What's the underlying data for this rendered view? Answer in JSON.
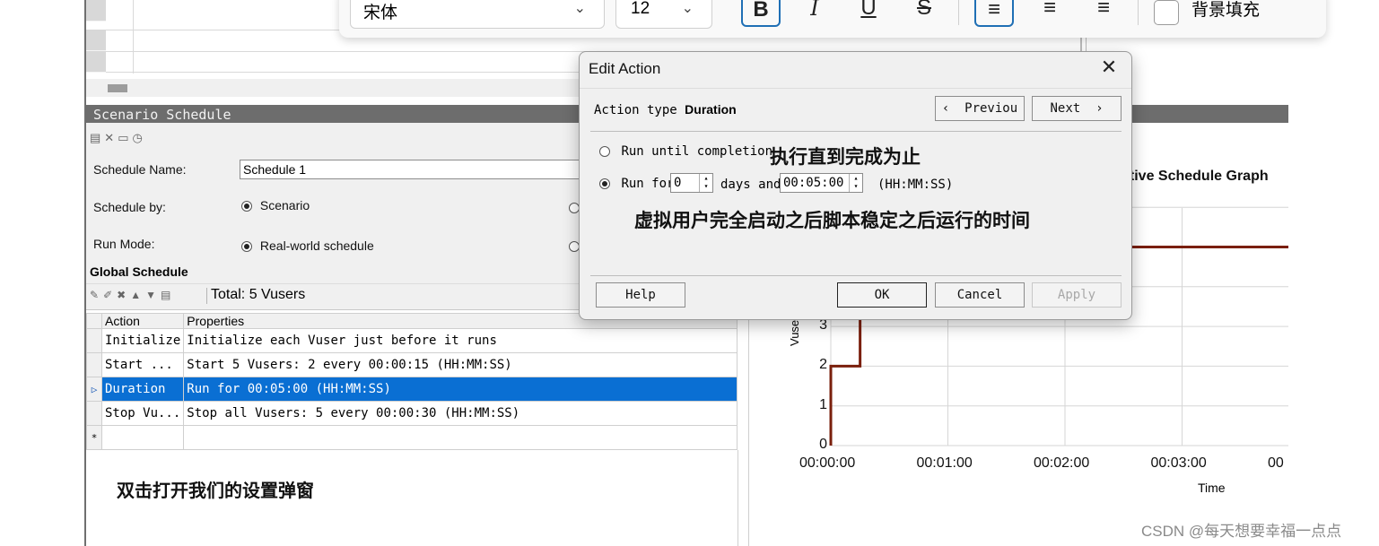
{
  "format_toolbar": {
    "font_name": "宋体",
    "font_size": "12",
    "bold": "B",
    "italic": "I",
    "underline": "U",
    "strikethrough": "S",
    "fill_label": "背景填充"
  },
  "scenario": {
    "title": "Scenario Schedule",
    "schedule_name_label": "Schedule Name:",
    "schedule_name_value": "Schedule 1",
    "schedule_by_label": "Schedule by:",
    "schedule_by_value": "Scenario",
    "run_mode_label": "Run Mode:",
    "run_mode_value": "Real-world schedule"
  },
  "global": {
    "title": "Global Schedule",
    "total": "Total: 5 Vusers",
    "columns": [
      "Action",
      "Properties"
    ],
    "rows": [
      {
        "action": "Initialize",
        "properties": "Initialize each Vuser just before it runs"
      },
      {
        "action": "Start  ...",
        "properties": "Start 5 Vusers: 2 every 00:00:15 (HH:MM:SS)"
      },
      {
        "action": "Duration",
        "properties": "Run for 00:05:00 (HH:MM:SS)"
      },
      {
        "action": "Stop Vu...",
        "properties": "Stop all Vusers: 5 every 00:00:30 (HH:MM:SS)"
      }
    ],
    "new_row_marker": "*",
    "selected_marker": "▷"
  },
  "annotation_bottom": "双击打开我们的设置弹窗",
  "graph": {
    "title": "ctive Schedule Graph",
    "x_ticks": [
      "00:00:00",
      "00:01:00",
      "00:02:00",
      "00:03:00",
      "00"
    ],
    "y_ticks": [
      "0",
      "1",
      "2",
      "3"
    ],
    "xlabel": "Time",
    "ylabel": "Vuse"
  },
  "chart_data": {
    "type": "line",
    "title": "ctive Schedule Graph",
    "xlabel": "Time",
    "ylabel": "Vuse",
    "series": [
      {
        "x_minutes": [
          0,
          0,
          0.25,
          0.25,
          0.5,
          5.0
        ],
        "y": [
          0,
          2,
          2,
          4,
          5,
          5
        ]
      }
    ],
    "x_ticks": [
      "00:00:00",
      "00:01:00",
      "00:02:00",
      "00:03:00",
      "00"
    ],
    "y_ticks": [
      0,
      1,
      2,
      3
    ],
    "grid": true,
    "line_color": "#7a1f0c"
  },
  "dialog": {
    "title": "Edit Action",
    "close": "✕",
    "action_type_label": "Action type",
    "action_type_value": "Duration",
    "prev_label": "Previou",
    "next_label": "Next",
    "option_completion": "Run until completion",
    "option_run_for": "Run for",
    "days_value": "0",
    "days_label": "days and",
    "time_value": "00:05:00",
    "time_unit": "(HH:MM:SS)",
    "help": "Help",
    "ok": "OK",
    "cancel": "Cancel",
    "apply": "Apply",
    "anno_completion": "执行直到完成为止",
    "anno_run_for": "虚拟用户完全启动之后脚本稳定之后运行的时间"
  },
  "watermark": "CSDN @每天想要幸福一点点",
  "colors": {
    "selection": "#0a6fd3",
    "graph_line": "#7a1f0c",
    "active_outline": "#1f6fb5"
  }
}
